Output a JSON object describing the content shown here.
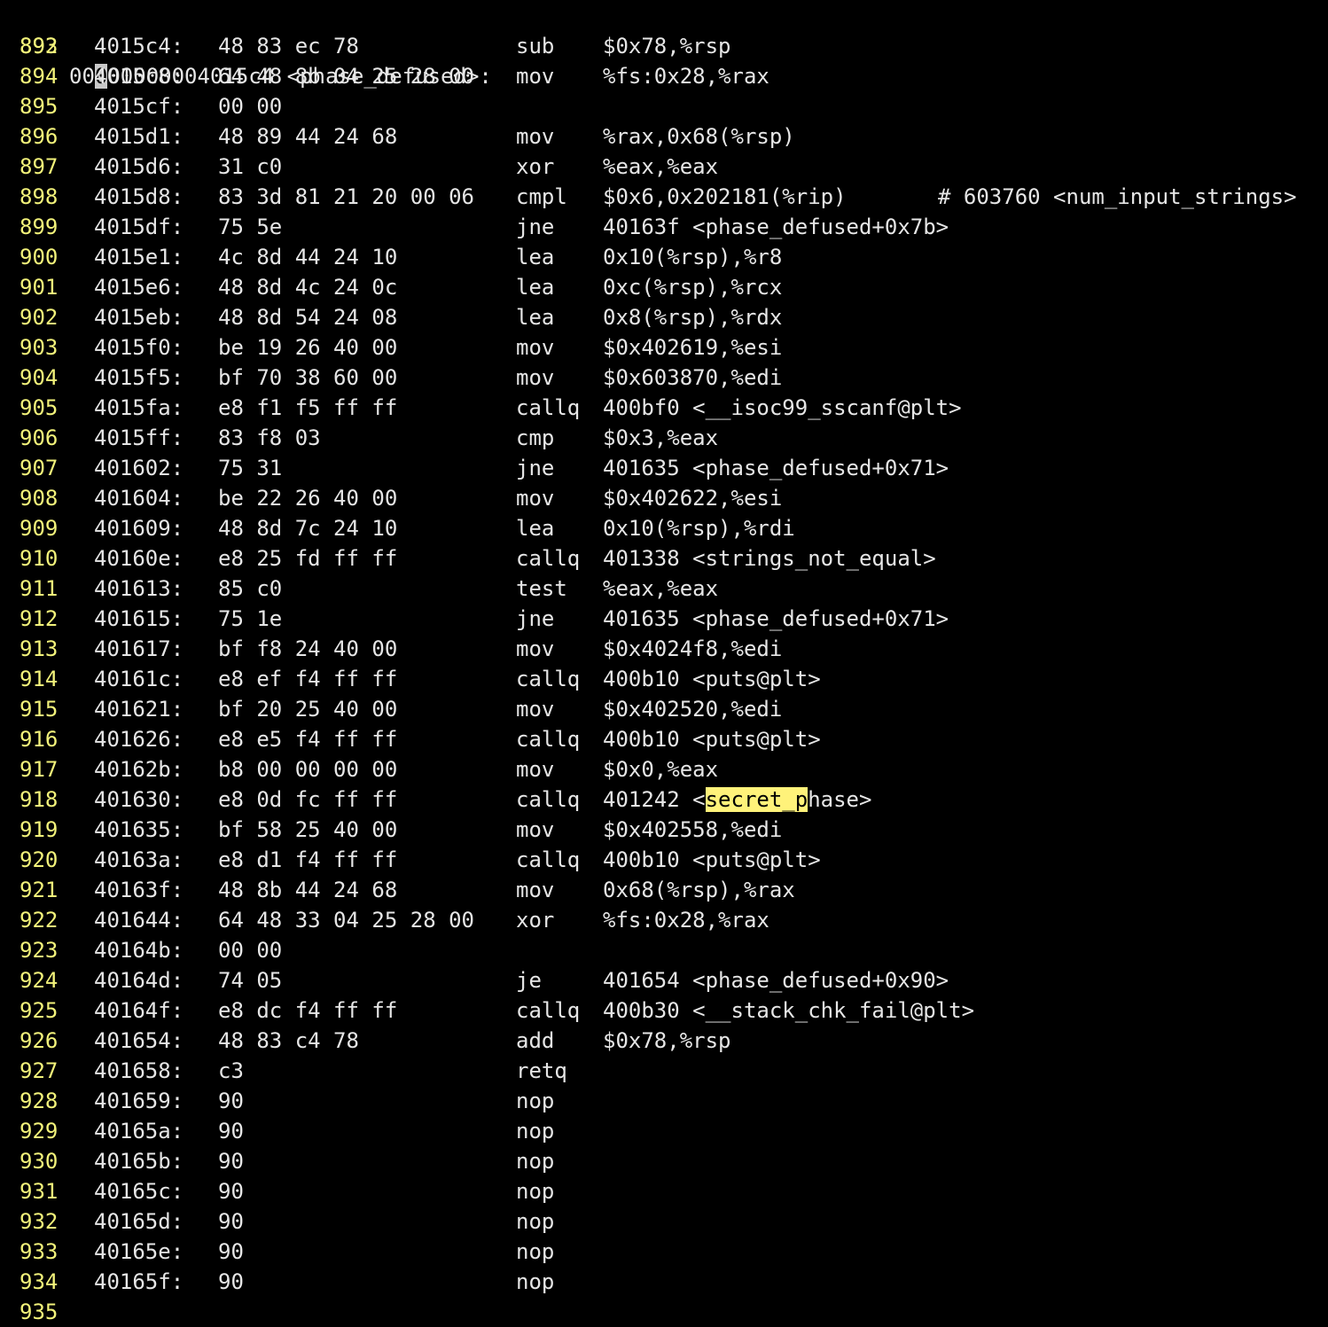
{
  "theme": {
    "background": "#000000",
    "text": "#e6e6e6",
    "line_number": "#f2f27a",
    "search_highlight": "#fff27a",
    "cursor": "#c9c9c9"
  },
  "header": {
    "line_number": "892",
    "cursor_before": "00",
    "cursor_char": "0",
    "cursor_after": "00000004015c4 <phase_defused>:"
  },
  "lines": [
    {
      "n": "893",
      "addr": "4015c4:",
      "bytes": "48 83 ec 78",
      "mn": "sub",
      "ops": "$0x78,%rsp"
    },
    {
      "n": "894",
      "addr": "4015c8:",
      "bytes": "64 48 8b 04 25 28 00",
      "mn": "mov",
      "ops": "%fs:0x28,%rax"
    },
    {
      "n": "895",
      "addr": "4015cf:",
      "bytes": "00 00",
      "mn": "",
      "ops": ""
    },
    {
      "n": "896",
      "addr": "4015d1:",
      "bytes": "48 89 44 24 68",
      "mn": "mov",
      "ops": "%rax,0x68(%rsp)"
    },
    {
      "n": "897",
      "addr": "4015d6:",
      "bytes": "31 c0",
      "mn": "xor",
      "ops": "%eax,%eax"
    },
    {
      "n": "898",
      "addr": "4015d8:",
      "bytes": "83 3d 81 21 20 00 06",
      "mn": "cmpl",
      "ops": "$0x6,0x202181(%rip)",
      "comment": "# 603760 <num_input_strings>"
    },
    {
      "n": "899",
      "addr": "4015df:",
      "bytes": "75 5e",
      "mn": "jne",
      "ops": "40163f <phase_defused+0x7b>"
    },
    {
      "n": "900",
      "addr": "4015e1:",
      "bytes": "4c 8d 44 24 10",
      "mn": "lea",
      "ops": "0x10(%rsp),%r8"
    },
    {
      "n": "901",
      "addr": "4015e6:",
      "bytes": "48 8d 4c 24 0c",
      "mn": "lea",
      "ops": "0xc(%rsp),%rcx"
    },
    {
      "n": "902",
      "addr": "4015eb:",
      "bytes": "48 8d 54 24 08",
      "mn": "lea",
      "ops": "0x8(%rsp),%rdx"
    },
    {
      "n": "903",
      "addr": "4015f0:",
      "bytes": "be 19 26 40 00",
      "mn": "mov",
      "ops": "$0x402619,%esi"
    },
    {
      "n": "904",
      "addr": "4015f5:",
      "bytes": "bf 70 38 60 00",
      "mn": "mov",
      "ops": "$0x603870,%edi"
    },
    {
      "n": "905",
      "addr": "4015fa:",
      "bytes": "e8 f1 f5 ff ff",
      "mn": "callq",
      "ops": "400bf0 <__isoc99_sscanf@plt>"
    },
    {
      "n": "906",
      "addr": "4015ff:",
      "bytes": "83 f8 03",
      "mn": "cmp",
      "ops": "$0x3,%eax"
    },
    {
      "n": "907",
      "addr": "401602:",
      "bytes": "75 31",
      "mn": "jne",
      "ops": "401635 <phase_defused+0x71>"
    },
    {
      "n": "908",
      "addr": "401604:",
      "bytes": "be 22 26 40 00",
      "mn": "mov",
      "ops": "$0x402622,%esi"
    },
    {
      "n": "909",
      "addr": "401609:",
      "bytes": "48 8d 7c 24 10",
      "mn": "lea",
      "ops": "0x10(%rsp),%rdi"
    },
    {
      "n": "910",
      "addr": "40160e:",
      "bytes": "e8 25 fd ff ff",
      "mn": "callq",
      "ops": "401338 <strings_not_equal>"
    },
    {
      "n": "911",
      "addr": "401613:",
      "bytes": "85 c0",
      "mn": "test",
      "ops": "%eax,%eax"
    },
    {
      "n": "912",
      "addr": "401615:",
      "bytes": "75 1e",
      "mn": "jne",
      "ops": "401635 <phase_defused+0x71>"
    },
    {
      "n": "913",
      "addr": "401617:",
      "bytes": "bf f8 24 40 00",
      "mn": "mov",
      "ops": "$0x4024f8,%edi"
    },
    {
      "n": "914",
      "addr": "40161c:",
      "bytes": "e8 ef f4 ff ff",
      "mn": "callq",
      "ops": "400b10 <puts@plt>"
    },
    {
      "n": "915",
      "addr": "401621:",
      "bytes": "bf 20 25 40 00",
      "mn": "mov",
      "ops": "$0x402520,%edi"
    },
    {
      "n": "916",
      "addr": "401626:",
      "bytes": "e8 e5 f4 ff ff",
      "mn": "callq",
      "ops": "400b10 <puts@plt>"
    },
    {
      "n": "917",
      "addr": "40162b:",
      "bytes": "b8 00 00 00 00",
      "mn": "mov",
      "ops": "$0x0,%eax"
    },
    {
      "n": "918",
      "addr": "401630:",
      "bytes": "e8 0d fc ff ff",
      "mn": "callq",
      "ops_pre": "401242 <",
      "ops_hl": "secret_p",
      "ops_post": "hase>"
    },
    {
      "n": "919",
      "addr": "401635:",
      "bytes": "bf 58 25 40 00",
      "mn": "mov",
      "ops": "$0x402558,%edi"
    },
    {
      "n": "920",
      "addr": "40163a:",
      "bytes": "e8 d1 f4 ff ff",
      "mn": "callq",
      "ops": "400b10 <puts@plt>"
    },
    {
      "n": "921",
      "addr": "40163f:",
      "bytes": "48 8b 44 24 68",
      "mn": "mov",
      "ops": "0x68(%rsp),%rax"
    },
    {
      "n": "922",
      "addr": "401644:",
      "bytes": "64 48 33 04 25 28 00",
      "mn": "xor",
      "ops": "%fs:0x28,%rax"
    },
    {
      "n": "923",
      "addr": "40164b:",
      "bytes": "00 00",
      "mn": "",
      "ops": ""
    },
    {
      "n": "924",
      "addr": "40164d:",
      "bytes": "74 05",
      "mn": "je",
      "ops": "401654 <phase_defused+0x90>"
    },
    {
      "n": "925",
      "addr": "40164f:",
      "bytes": "e8 dc f4 ff ff",
      "mn": "callq",
      "ops": "400b30 <__stack_chk_fail@plt>"
    },
    {
      "n": "926",
      "addr": "401654:",
      "bytes": "48 83 c4 78",
      "mn": "add",
      "ops": "$0x78,%rsp"
    },
    {
      "n": "927",
      "addr": "401658:",
      "bytes": "c3",
      "mn": "retq",
      "ops": ""
    },
    {
      "n": "928",
      "addr": "401659:",
      "bytes": "90",
      "mn": "nop",
      "ops": ""
    },
    {
      "n": "929",
      "addr": "40165a:",
      "bytes": "90",
      "mn": "nop",
      "ops": ""
    },
    {
      "n": "930",
      "addr": "40165b:",
      "bytes": "90",
      "mn": "nop",
      "ops": ""
    },
    {
      "n": "931",
      "addr": "40165c:",
      "bytes": "90",
      "mn": "nop",
      "ops": ""
    },
    {
      "n": "932",
      "addr": "40165d:",
      "bytes": "90",
      "mn": "nop",
      "ops": ""
    },
    {
      "n": "933",
      "addr": "40165e:",
      "bytes": "90",
      "mn": "nop",
      "ops": ""
    },
    {
      "n": "934",
      "addr": "40165f:",
      "bytes": "90",
      "mn": "nop",
      "ops": ""
    },
    {
      "n": "935"
    }
  ]
}
